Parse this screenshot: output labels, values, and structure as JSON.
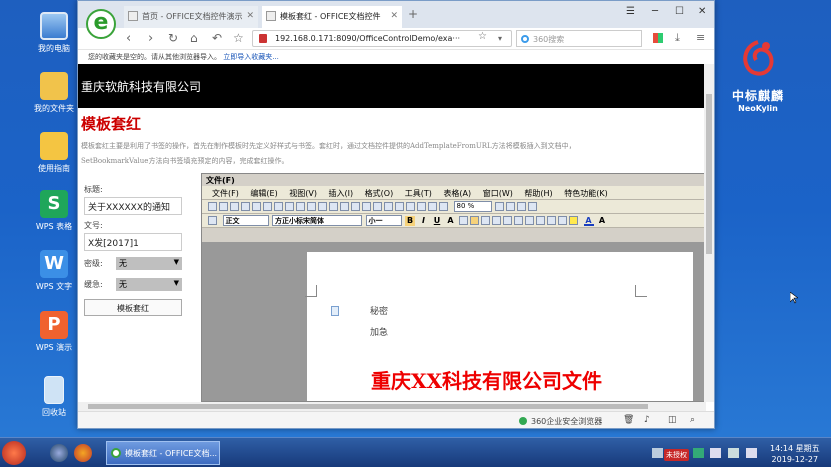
{
  "desktop": {
    "icons": [
      {
        "label": "我的电脑"
      },
      {
        "label": "我的文件夹"
      },
      {
        "label": "使用指南"
      },
      {
        "label": "WPS 表格"
      },
      {
        "label": "WPS 文字"
      },
      {
        "label": "WPS 演示"
      },
      {
        "label": "回收站"
      }
    ],
    "logo": {
      "cn": "中标麒麟",
      "en": "NeoKylin"
    }
  },
  "browser": {
    "tabs": [
      {
        "label": "首页 - OFFICE文档控件演示"
      },
      {
        "label": "模板套红 - OFFICE文档控件"
      }
    ],
    "url": "192.168.0.171:8090/OfficeControlDemo/exa···",
    "search_placeholder": "360搜索",
    "favbar_text": "您的收藏夹是空的。请从其他浏览器导入。",
    "favbar_link": "立即导入收藏夹...",
    "status_text": "360企业安全浏览器"
  },
  "page": {
    "banner": "重庆软航科技有限公司",
    "title": "模板套红",
    "desc_line1": "模板套红主要是利用了书签的操作，首先在制作模板时先定义好样式与书签。套红时，通过文档控件提供的AddTemplateFromURL方法将模板插入到文档中，",
    "desc_line2": "SetBookmarkValue方法向书签填充预定的内容，完成套红操作。",
    "form": {
      "title_label": "标题:",
      "title_value": "关于XXXXXX的通知",
      "docno_label": "文号:",
      "docno_value": "X发[2017]1",
      "secret_label": "密级:",
      "secret_value": "无",
      "urgency_label": "缓急:",
      "urgency_value": "无",
      "button_label": "模板套红"
    }
  },
  "office": {
    "file_menu": "文件(F)",
    "menus": [
      "文件(F)",
      "编辑(E)",
      "视图(V)",
      "插入(I)",
      "格式(O)",
      "工具(T)",
      "表格(A)",
      "窗口(W)",
      "帮助(H)",
      "特色功能(K)"
    ],
    "zoom": "80 %",
    "style": "正文",
    "font": "方正小标宋简体",
    "size": "小一",
    "doc": {
      "line1": "秘密",
      "line2": "加急",
      "red_header": "重庆XX科技有限公司文件"
    }
  },
  "taskbar": {
    "task_label": "模板套红 - OFFICE文档...",
    "badge": "未授权",
    "time": "14:14 星期五",
    "date": "2019-12-27"
  }
}
